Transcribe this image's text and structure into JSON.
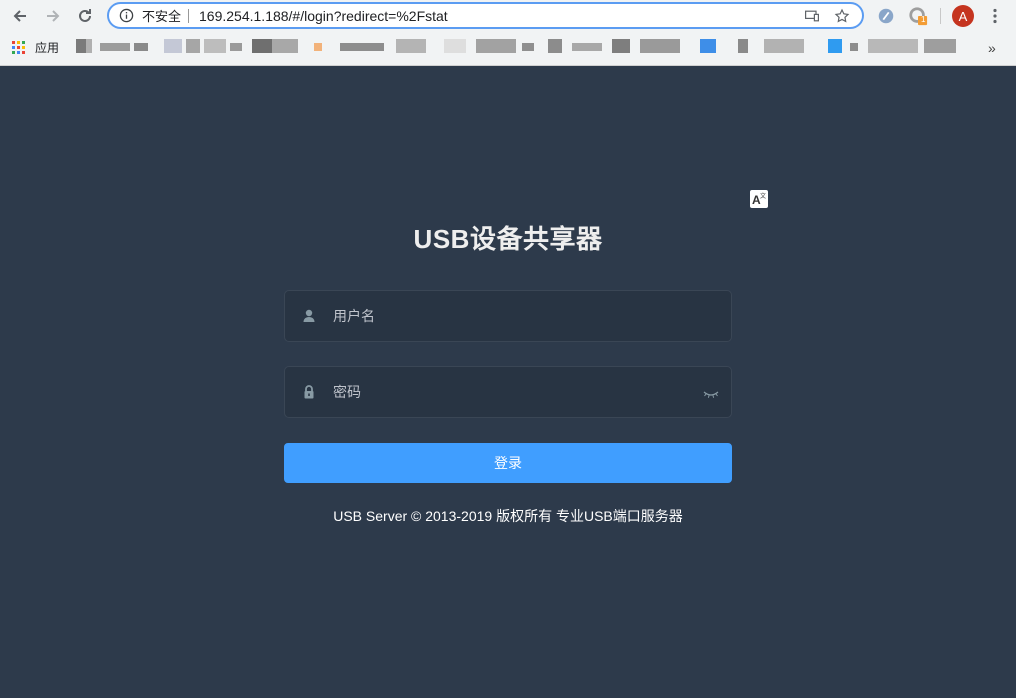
{
  "browser": {
    "omnibox": {
      "security_label": "不安全",
      "url": "169.254.1.188/#/login?redirect=%2Fstat"
    },
    "icons": {
      "back": "back-arrow-icon",
      "forward": "forward-arrow-icon",
      "reload": "reload-icon",
      "info": "info-icon",
      "cast": "cast-icon",
      "bookmark": "star-icon",
      "menu": "more-vert-icon"
    },
    "extension_badge": "1",
    "avatar_letter": "A",
    "bookmarks": {
      "apps_label": "应用",
      "overflow": "»"
    }
  },
  "login": {
    "title": "USB设备共享器",
    "username_placeholder": "用户名",
    "password_placeholder": "密码",
    "submit_label": "登录",
    "footer": "USB Server © 2013-2019 版权所有 专业USB端口服务器"
  },
  "colors": {
    "page_bg": "#2d3a4b",
    "input_bg": "#283443",
    "primary": "#409eff"
  }
}
